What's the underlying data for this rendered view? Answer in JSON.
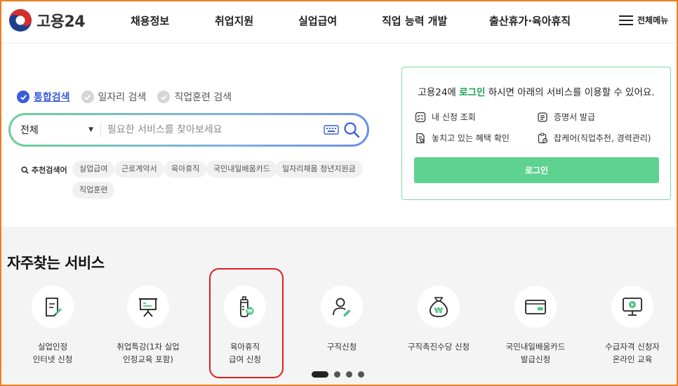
{
  "header": {
    "logo_text": "고용24",
    "nav": [
      "채용정보",
      "취업지원",
      "실업급여",
      "직업 능력 개발",
      "출산휴가·육아휴직"
    ],
    "menu_all": "전체메뉴"
  },
  "search": {
    "tabs": [
      {
        "label": "통합검색",
        "active": true
      },
      {
        "label": "일자리 검색",
        "active": false
      },
      {
        "label": "직업훈련 검색",
        "active": false
      }
    ],
    "select_value": "전체",
    "placeholder": "필요한 서비스를 찾아보세요",
    "recommended_label": "추천검색어",
    "keywords": [
      "실업급여",
      "근로계약서",
      "육아휴직",
      "국민내일배움카드",
      "일자리채움 청년지원금",
      "직업훈련"
    ]
  },
  "login": {
    "msg_pre": "고용24에 ",
    "msg_highlight": "로그인",
    "msg_post": " 하시면 아래의 서비스를 이용할 수 있어요.",
    "items": [
      "내 신청 조회",
      "증명서 발급",
      "놓치고 있는 혜택 확인",
      "잡케어(직업추천, 경력관리)"
    ],
    "button": "로그인",
    "accent_color": "#1fa255",
    "button_color": "#5ed290"
  },
  "services": {
    "title": "자주찾는 서비스",
    "items": [
      {
        "line1": "실업인정",
        "line2": "인터넷 신청",
        "icon": "document-pen-icon"
      },
      {
        "line1": "취업특강(1차 실업",
        "line2": "인정교육 포함)",
        "icon": "presentation-board-icon"
      },
      {
        "line1": "육아휴직",
        "line2": "급여 신청",
        "icon": "baby-bottle-icon"
      },
      {
        "line1": "구직신청",
        "line2": "",
        "icon": "person-pen-icon"
      },
      {
        "line1": "구직촉진수당 신청",
        "line2": "",
        "icon": "money-bag-icon"
      },
      {
        "line1": "국민내일배움카드",
        "line2": "발급신청",
        "icon": "card-icon"
      },
      {
        "line1": "수급자격 신청자",
        "line2": "온라인 교육",
        "icon": "monitor-play-icon"
      }
    ],
    "highlight_color": "#e21d1d"
  }
}
